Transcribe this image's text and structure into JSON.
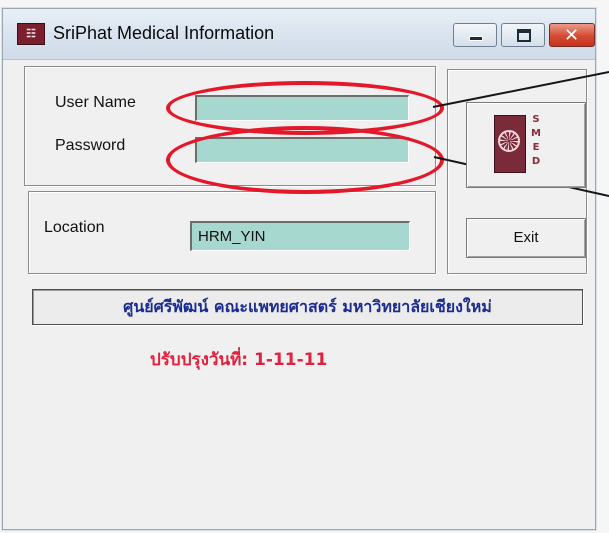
{
  "window": {
    "title": "SriPhat Medical Information"
  },
  "login": {
    "username_label": "User Name",
    "password_label": "Password",
    "username_value": "",
    "password_value": ""
  },
  "location": {
    "label": "Location",
    "value": "HRM_YIN"
  },
  "buttons": {
    "exit_label": "Exit"
  },
  "logo": {
    "letters": "SMED"
  },
  "banner": {
    "text": "ศูนย์ศรีพัฒน์ คณะแพทยศาสตร์ มหาวิทยาลัยเชียงใหม่"
  },
  "update": {
    "text": "ปรับปรุงวันที่: 1-11-11"
  },
  "colors": {
    "field_bg": "#a6d8cf",
    "highlight": "#e3192b",
    "banner_text": "#1b2c8e",
    "update_text": "#e0213f"
  }
}
